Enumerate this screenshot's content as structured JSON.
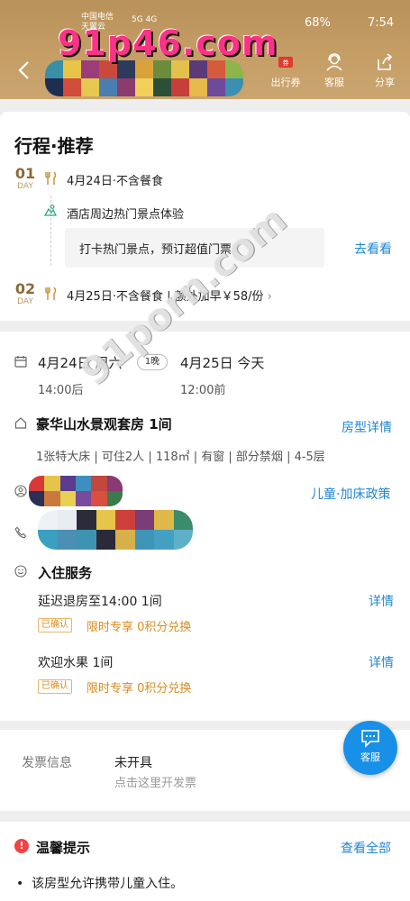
{
  "status_bar": {
    "carrier_line1": "中国电信",
    "carrier_line2": "天翼云",
    "network": "5G 4G",
    "battery": "68%",
    "time": "7:54"
  },
  "header": {
    "actions": [
      {
        "label": "出行券",
        "icon": "ticket-icon"
      },
      {
        "label": "客服",
        "icon": "customer-service-icon"
      },
      {
        "label": "分享",
        "icon": "share-icon"
      }
    ]
  },
  "watermarks": [
    "91p46.com",
    "91porn.com"
  ],
  "recommendation": {
    "title": "行程·推荐",
    "day1": {
      "num": "01",
      "label": "DAY",
      "text": "4月24日·不含餐食"
    },
    "poi": "酒店周边热门景点体验",
    "tip": "打卡热门景点，预订超值门票",
    "tip_link": "去看看",
    "day2": {
      "num": "02",
      "label": "DAY",
      "text": "4月25日·不含餐食 | 额外加早￥58/份"
    }
  },
  "booking": {
    "checkin_date": "4月24日 周六",
    "nights": "1晚",
    "checkout_date": "4月25日 今天",
    "checkin_time": "14:00后",
    "checkout_time": "12:00前",
    "room_name": "豪华山水景观套房  1间",
    "room_link": "房型详情",
    "room_desc": "1张特大床 | 可住2人 | 118㎡ | 有窗 | 部分禁烟 | 4-5层",
    "policy_link": "儿童·加床政策",
    "services_title": "入住服务",
    "services": [
      {
        "name": "延迟退房至14:00   1间",
        "link": "详情",
        "tag": "已确认",
        "promo": "限时专享 0积分兑换"
      },
      {
        "name": "欢迎水果   1间",
        "link": "详情",
        "tag": "已确认",
        "promo": "限时专享 0积分兑换"
      }
    ]
  },
  "invoice": {
    "label": "发票信息",
    "status": "未开具",
    "hint": "点击这里开发票"
  },
  "float_button": {
    "label": "客服"
  },
  "notice": {
    "title": "温馨提示",
    "link": "查看全部",
    "items": [
      "该房型允许携带儿童入住。"
    ]
  },
  "colors": {
    "header_gold": "#c49d65",
    "link_blue": "#1f86d4",
    "promo_orange": "#d98b1c",
    "day_brown": "#8a6a3a"
  }
}
